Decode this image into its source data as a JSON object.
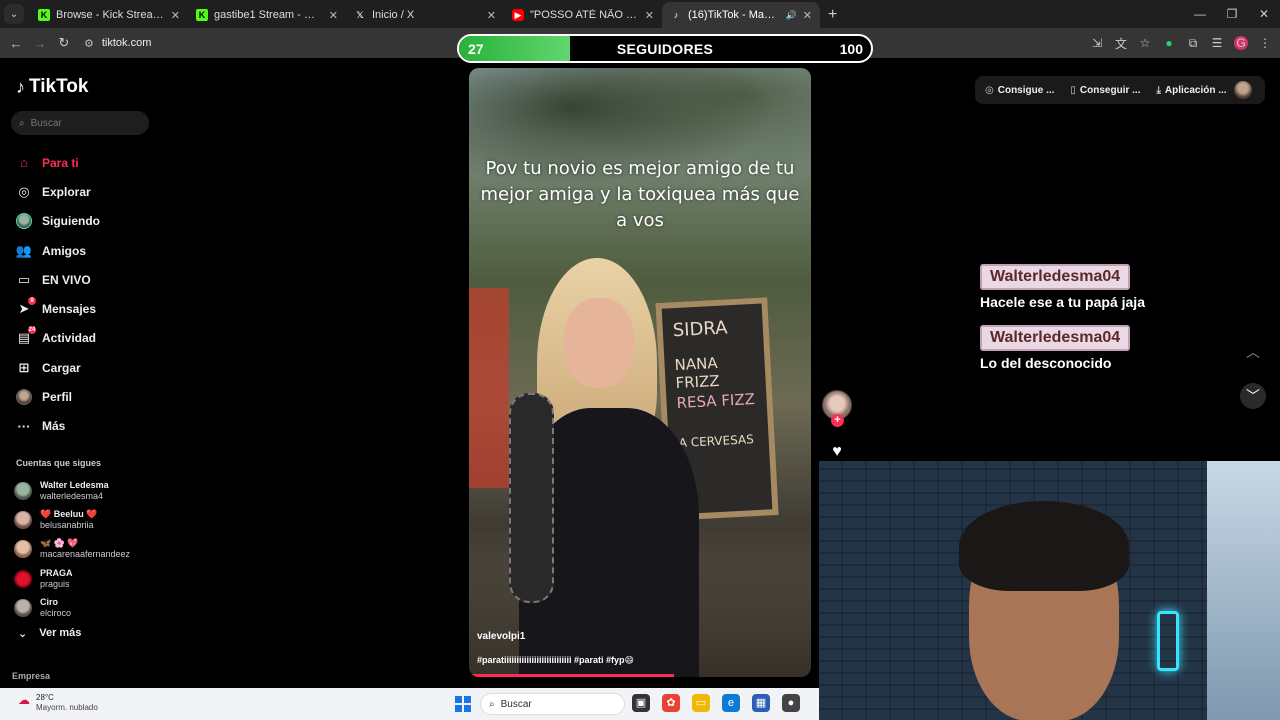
{
  "browser": {
    "tabs": [
      {
        "title": "Browse - Kick Streaming",
        "favicon": "kick-icon",
        "active": false
      },
      {
        "title": "gastibe1 Stream - Watch Live o",
        "favicon": "kick-icon",
        "active": false
      },
      {
        "title": "Inicio / X",
        "favicon": "x-icon",
        "active": false
      },
      {
        "title": "\"POSSO ATÉ NÃO TE DAR FLOR",
        "favicon": "youtube-icon",
        "active": false
      },
      {
        "title": "(16)TikTok - Make Your Day",
        "favicon": "tiktok-icon",
        "active": true
      }
    ],
    "url": "tiktok.com"
  },
  "goal": {
    "current": "27",
    "label": "SEGUIDORES",
    "target": "100",
    "progress": 0.27,
    "fill_color": "#3cc24a"
  },
  "sidebar": {
    "logo": "TikTok",
    "search_placeholder": "Buscar",
    "nav": [
      {
        "label": "Para ti",
        "icon": "home-icon",
        "active": true
      },
      {
        "label": "Explorar",
        "icon": "compass-icon"
      },
      {
        "label": "Siguiendo",
        "icon": "following-avatar-icon"
      },
      {
        "label": "Amigos",
        "icon": "friends-icon"
      },
      {
        "label": "EN VIVO",
        "icon": "live-icon"
      },
      {
        "label": "Mensajes",
        "icon": "messages-icon",
        "badge": "9"
      },
      {
        "label": "Actividad",
        "icon": "activity-icon",
        "badge": "24"
      },
      {
        "label": "Cargar",
        "icon": "upload-icon"
      },
      {
        "label": "Perfil",
        "icon": "profile-avatar-icon"
      },
      {
        "label": "Más",
        "icon": "more-icon"
      }
    ],
    "following_heading": "Cuentas que sigues",
    "following": [
      {
        "name": "Walter Ledesma",
        "handle": "walterledesma4"
      },
      {
        "name": "❤️ Beeluu ❤️",
        "handle": "belusanabriia"
      },
      {
        "name": "🦋 🌸 💖",
        "handle": "macarenaafernandeez"
      },
      {
        "name": "PRAGA",
        "handle": "praguis"
      },
      {
        "name": "Ciro",
        "handle": "elciroco"
      }
    ],
    "see_more": "Ver más",
    "company": "Empresa"
  },
  "video": {
    "caption": "Pov tu novio es mejor amigo de tu mejor amiga y la toxiquea más que a vos",
    "author": "valevolpi1",
    "tags": "#paratiiiiiiiiiiiiiiiiiiiiiiiiiii #parati #fyp😄",
    "board_lines": [
      "SIDRA",
      "NANA FRIZZ",
      "RESA FIZZ",
      "A CERVESAS"
    ],
    "progress": 0.6
  },
  "top_right": {
    "pills": [
      {
        "label": "Consigue ...",
        "icon": "coin-icon"
      },
      {
        "label": "Conseguir ...",
        "icon": "phone-icon"
      },
      {
        "label": "Aplicación ...",
        "icon": "download-icon"
      }
    ]
  },
  "chat": [
    {
      "user": "Walterledesma04",
      "text": "Hacele ese a tu papá jaja"
    },
    {
      "user": "Walterledesma04",
      "text": "Lo del desconocido"
    }
  ],
  "taskbar": {
    "temp": "28°C",
    "weather": "Mayorm. nublado",
    "search": "Buscar"
  }
}
